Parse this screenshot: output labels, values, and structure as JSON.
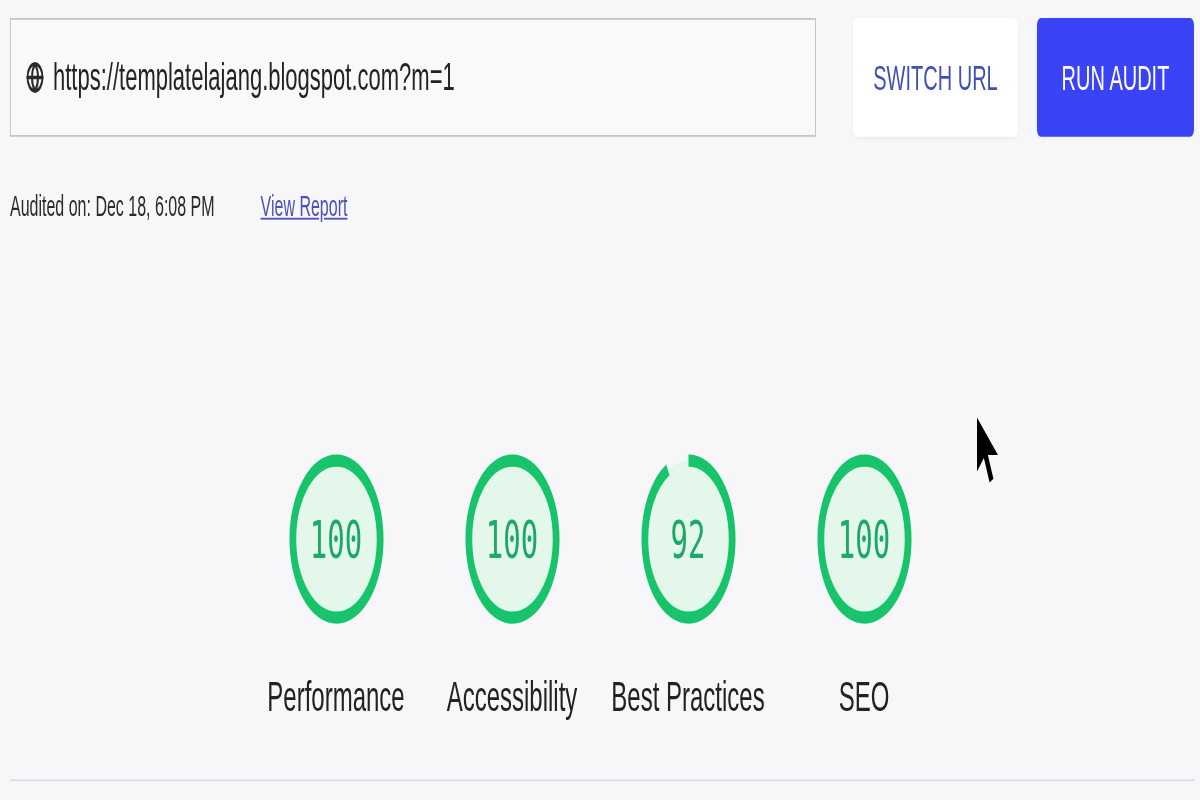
{
  "url_field": {
    "value": "https://templatelajang.blogspot.com?m=1"
  },
  "buttons": [
    {
      "label": "SWITCH URL",
      "kind": "secondary"
    },
    {
      "label": "RUN AUDIT",
      "kind": "primary"
    }
  ],
  "audit_info": {
    "audited_on": "Audited on: Dec 18, 6:08 PM",
    "link": "View Report"
  },
  "gauges": [
    {
      "score": "100",
      "label": "Performance",
      "level": 1
    },
    {
      "score": "100",
      "label": "Accessibility",
      "level": 1
    },
    {
      "score": "92",
      "label": "Best Practices",
      "level": 0.92
    },
    {
      "score": "100",
      "label": "SEO",
      "level": 1
    }
  ]
}
